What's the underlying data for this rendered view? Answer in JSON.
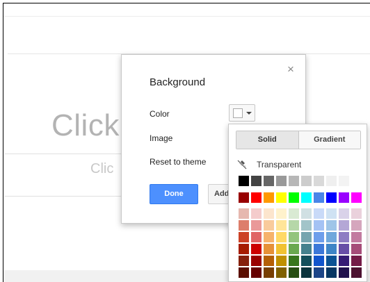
{
  "background_slide": {
    "title_placeholder": "Click",
    "subtitle_placeholder": "Clic"
  },
  "dialog": {
    "title": "Background",
    "close_icon": "close-icon",
    "rows": {
      "color": "Color",
      "image": "Image",
      "reset": "Reset to theme"
    },
    "current_color": "#ffffff",
    "done_label": "Done",
    "add_label": "Add to theme"
  },
  "color_picker": {
    "tabs": [
      {
        "label": "Solid",
        "selected": true
      },
      {
        "label": "Gradient",
        "selected": false
      }
    ],
    "transparent_label": "Transparent",
    "transparent_icon": "no-fill-icon",
    "grayscale_row": [
      "#000000",
      "#434343",
      "#666666",
      "#999999",
      "#b7b7b7",
      "#cccccc",
      "#d9d9d9",
      "#efefef",
      "#f3f3f3",
      "#ffffff"
    ],
    "bright_row": [
      "#980000",
      "#ff0000",
      "#ff9900",
      "#ffff00",
      "#00ff00",
      "#00ffff",
      "#4a86e8",
      "#0000ff",
      "#9900ff",
      "#ff00ff"
    ],
    "shade_rows": [
      [
        "#e6b8af",
        "#f4cccc",
        "#fce5cd",
        "#fff2cc",
        "#d9ead3",
        "#d0e0e3",
        "#c9daf8",
        "#cfe2f3",
        "#d9d2e9",
        "#ead1dc"
      ],
      [
        "#dd7e6b",
        "#ea9999",
        "#f9cb9c",
        "#ffe599",
        "#b6d7a8",
        "#a2c4c9",
        "#a4c2f4",
        "#9fc5e8",
        "#b4a7d6",
        "#d5a6bd"
      ],
      [
        "#cc4125",
        "#e06666",
        "#f6b26b",
        "#ffd966",
        "#93c47d",
        "#76a5af",
        "#6d9eeb",
        "#6fa8dc",
        "#8e7cc3",
        "#c27ba0"
      ],
      [
        "#a61c00",
        "#cc0000",
        "#e69138",
        "#f1c232",
        "#6aa84f",
        "#45818e",
        "#3c78d8",
        "#3d85c6",
        "#674ea7",
        "#a64d79"
      ],
      [
        "#85200c",
        "#990000",
        "#b45f06",
        "#bf9000",
        "#38761d",
        "#134f5c",
        "#1155cc",
        "#0b5394",
        "#351c75",
        "#741b47"
      ],
      [
        "#5b0f00",
        "#660000",
        "#783f04",
        "#7f6000",
        "#274e13",
        "#0c343d",
        "#1c4587",
        "#073763",
        "#20124d",
        "#4c1130"
      ]
    ]
  }
}
